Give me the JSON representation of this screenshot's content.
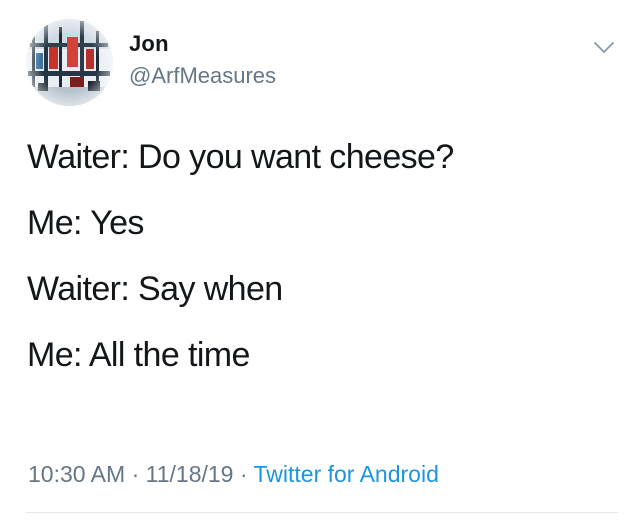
{
  "user": {
    "display_name": "Jon",
    "handle": "@ArfMeasures"
  },
  "tweet": {
    "lines": [
      "Waiter: Do you want cheese?",
      "Me: Yes",
      "Waiter: Say when",
      "Me: All the time"
    ],
    "time": "10:30 AM",
    "separator": " · ",
    "date": "11/18/19",
    "source": "Twitter for Android"
  },
  "icons": {
    "avatar": "avatar-photo",
    "menu": "chevron-down-icon"
  },
  "colors": {
    "text": "#14171a",
    "secondary": "#657786",
    "link": "#1b95e0",
    "divider": "#e1e8ed"
  }
}
